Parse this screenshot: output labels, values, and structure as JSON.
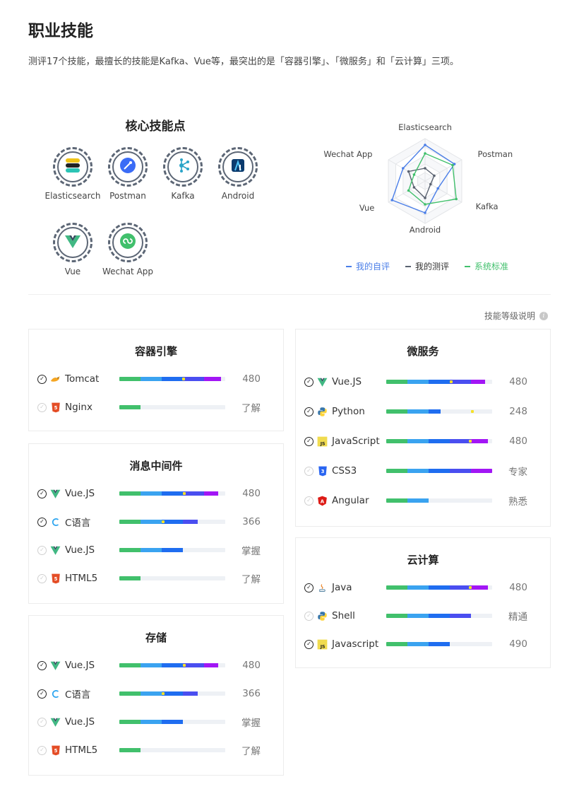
{
  "page": {
    "title": "职业技能",
    "summary": "测评17个技能，最擅长的技能是Kafka、Vue等，最突出的是「容器引擎」、「微服务」和「云计算」三项。"
  },
  "core": {
    "title": "核心技能点",
    "badges": [
      {
        "label": "Elasticsearch",
        "icon": "elasticsearch-icon"
      },
      {
        "label": "Postman",
        "icon": "postman-icon"
      },
      {
        "label": "Kafka",
        "icon": "kafka-icon"
      },
      {
        "label": "Android",
        "icon": "android-studio-icon"
      },
      {
        "label": "Vue",
        "icon": "vue-icon"
      },
      {
        "label": "Wechat App",
        "icon": "wechat-miniprogram-icon"
      }
    ]
  },
  "chart_data": {
    "type": "radar",
    "axes": [
      "Elasticsearch",
      "Postman",
      "Kafka",
      "Android",
      "Vue",
      "Wechat App"
    ],
    "range": [
      0,
      1
    ],
    "series": [
      {
        "name": "我的自评",
        "color": "#4a7ee8",
        "values": [
          0.85,
          0.8,
          0.35,
          0.75,
          0.9,
          0.6
        ]
      },
      {
        "name": "我的测评",
        "color": "#5a6270",
        "values": [
          0.3,
          0.25,
          0.15,
          0.4,
          0.3,
          0.45
        ]
      },
      {
        "name": "系统标准",
        "color": "#41c06c",
        "values": [
          0.65,
          0.75,
          0.85,
          0.55,
          0.45,
          0.3
        ]
      }
    ],
    "legend_position": "bottom"
  },
  "legend": {
    "self": "我的自评",
    "test": "我的测评",
    "standard": "系统标准"
  },
  "level_link": "技能等级说明",
  "colors": {
    "green": "#41c06c",
    "lightblue": "#3aa3f0",
    "blue": "#1f6df0",
    "indigo": "#4a4ef0",
    "purple": "#a216f5"
  },
  "cards": {
    "container": {
      "title": "容器引擎",
      "rows": [
        {
          "name": "Tomcat",
          "icon": "tomcat-icon",
          "checked": true,
          "value": "480",
          "fill": 0.96,
          "dot": 0.59
        },
        {
          "name": "Nginx",
          "icon": "html5-icon",
          "checked": false,
          "value": "了解",
          "fill": 0.2,
          "dot": null
        }
      ]
    },
    "mq": {
      "title": "消息中间件",
      "rows": [
        {
          "name": "Vue.JS",
          "icon": "vue-icon",
          "checked": true,
          "value": "480",
          "fill": 0.93,
          "dot": 0.6
        },
        {
          "name": "C语言",
          "icon": "c-language-icon",
          "checked": true,
          "value": "366",
          "fill": 0.74,
          "dot": 0.4
        },
        {
          "name": "Vue.JS",
          "icon": "vue-icon",
          "checked": false,
          "value": "掌握",
          "fill": 0.6,
          "dot": null
        },
        {
          "name": "HTML5",
          "icon": "html5-icon",
          "checked": false,
          "value": "了解",
          "fill": 0.2,
          "dot": null
        }
      ]
    },
    "storage": {
      "title": "存储",
      "rows": [
        {
          "name": "Vue.JS",
          "icon": "vue-icon",
          "checked": true,
          "value": "480",
          "fill": 0.93,
          "dot": 0.6
        },
        {
          "name": "C语言",
          "icon": "c-language-icon",
          "checked": true,
          "value": "366",
          "fill": 0.74,
          "dot": 0.4
        },
        {
          "name": "Vue.JS",
          "icon": "vue-icon",
          "checked": false,
          "value": "掌握",
          "fill": 0.6,
          "dot": null
        },
        {
          "name": "HTML5",
          "icon": "html5-icon",
          "checked": false,
          "value": "了解",
          "fill": 0.2,
          "dot": null
        }
      ]
    },
    "micro": {
      "title": "微服务",
      "rows": [
        {
          "name": "Vue.JS",
          "icon": "vue-icon",
          "checked": true,
          "value": "480",
          "fill": 0.93,
          "dot": 0.6
        },
        {
          "name": "Python",
          "icon": "python-icon",
          "checked": true,
          "value": "248",
          "fill": 0.51,
          "dot": 0.8
        },
        {
          "name": "JavaScript",
          "icon": "javascript-icon",
          "checked": true,
          "value": "480",
          "fill": 0.96,
          "dot": 0.78
        },
        {
          "name": "CSS3",
          "icon": "css3-icon",
          "checked": false,
          "value": "专家",
          "fill": 1.0,
          "dot": null
        },
        {
          "name": "Angular",
          "icon": "angular-icon",
          "checked": false,
          "value": "熟悉",
          "fill": 0.4,
          "dot": null
        }
      ]
    },
    "cloud": {
      "title": "云计算",
      "rows": [
        {
          "name": "Java",
          "icon": "java-icon",
          "checked": true,
          "value": "480",
          "fill": 0.96,
          "dot": 0.78
        },
        {
          "name": "Shell",
          "icon": "python-icon",
          "checked": false,
          "value": "精通",
          "fill": 0.8,
          "dot": null
        },
        {
          "name": "Javascript",
          "icon": "javascript-icon",
          "checked": true,
          "value": "490",
          "fill": 0.6,
          "dot": null
        }
      ]
    }
  }
}
